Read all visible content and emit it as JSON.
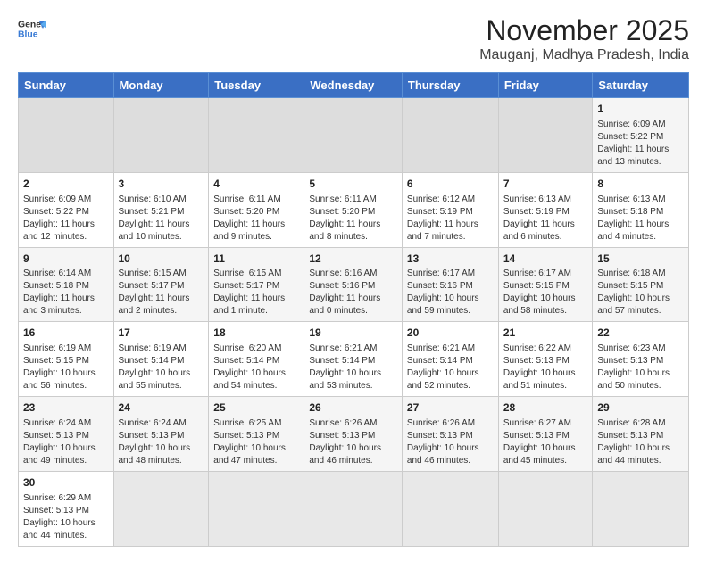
{
  "header": {
    "logo_general": "General",
    "logo_blue": "Blue",
    "month_title": "November 2025",
    "location": "Mauganj, Madhya Pradesh, India"
  },
  "days_of_week": [
    "Sunday",
    "Monday",
    "Tuesday",
    "Wednesday",
    "Thursday",
    "Friday",
    "Saturday"
  ],
  "weeks": [
    [
      {
        "day": "",
        "info": ""
      },
      {
        "day": "",
        "info": ""
      },
      {
        "day": "",
        "info": ""
      },
      {
        "day": "",
        "info": ""
      },
      {
        "day": "",
        "info": ""
      },
      {
        "day": "",
        "info": ""
      },
      {
        "day": "1",
        "info": "Sunrise: 6:09 AM\nSunset: 5:22 PM\nDaylight: 11 hours\nand 13 minutes."
      }
    ],
    [
      {
        "day": "2",
        "info": "Sunrise: 6:09 AM\nSunset: 5:22 PM\nDaylight: 11 hours\nand 12 minutes."
      },
      {
        "day": "3",
        "info": "Sunrise: 6:10 AM\nSunset: 5:21 PM\nDaylight: 11 hours\nand 10 minutes."
      },
      {
        "day": "4",
        "info": "Sunrise: 6:11 AM\nSunset: 5:20 PM\nDaylight: 11 hours\nand 9 minutes."
      },
      {
        "day": "5",
        "info": "Sunrise: 6:11 AM\nSunset: 5:20 PM\nDaylight: 11 hours\nand 8 minutes."
      },
      {
        "day": "6",
        "info": "Sunrise: 6:12 AM\nSunset: 5:19 PM\nDaylight: 11 hours\nand 7 minutes."
      },
      {
        "day": "7",
        "info": "Sunrise: 6:13 AM\nSunset: 5:19 PM\nDaylight: 11 hours\nand 6 minutes."
      },
      {
        "day": "8",
        "info": "Sunrise: 6:13 AM\nSunset: 5:18 PM\nDaylight: 11 hours\nand 4 minutes."
      }
    ],
    [
      {
        "day": "9",
        "info": "Sunrise: 6:14 AM\nSunset: 5:18 PM\nDaylight: 11 hours\nand 3 minutes."
      },
      {
        "day": "10",
        "info": "Sunrise: 6:15 AM\nSunset: 5:17 PM\nDaylight: 11 hours\nand 2 minutes."
      },
      {
        "day": "11",
        "info": "Sunrise: 6:15 AM\nSunset: 5:17 PM\nDaylight: 11 hours\nand 1 minute."
      },
      {
        "day": "12",
        "info": "Sunrise: 6:16 AM\nSunset: 5:16 PM\nDaylight: 11 hours\nand 0 minutes."
      },
      {
        "day": "13",
        "info": "Sunrise: 6:17 AM\nSunset: 5:16 PM\nDaylight: 10 hours\nand 59 minutes."
      },
      {
        "day": "14",
        "info": "Sunrise: 6:17 AM\nSunset: 5:15 PM\nDaylight: 10 hours\nand 58 minutes."
      },
      {
        "day": "15",
        "info": "Sunrise: 6:18 AM\nSunset: 5:15 PM\nDaylight: 10 hours\nand 57 minutes."
      }
    ],
    [
      {
        "day": "16",
        "info": "Sunrise: 6:19 AM\nSunset: 5:15 PM\nDaylight: 10 hours\nand 56 minutes."
      },
      {
        "day": "17",
        "info": "Sunrise: 6:19 AM\nSunset: 5:14 PM\nDaylight: 10 hours\nand 55 minutes."
      },
      {
        "day": "18",
        "info": "Sunrise: 6:20 AM\nSunset: 5:14 PM\nDaylight: 10 hours\nand 54 minutes."
      },
      {
        "day": "19",
        "info": "Sunrise: 6:21 AM\nSunset: 5:14 PM\nDaylight: 10 hours\nand 53 minutes."
      },
      {
        "day": "20",
        "info": "Sunrise: 6:21 AM\nSunset: 5:14 PM\nDaylight: 10 hours\nand 52 minutes."
      },
      {
        "day": "21",
        "info": "Sunrise: 6:22 AM\nSunset: 5:13 PM\nDaylight: 10 hours\nand 51 minutes."
      },
      {
        "day": "22",
        "info": "Sunrise: 6:23 AM\nSunset: 5:13 PM\nDaylight: 10 hours\nand 50 minutes."
      }
    ],
    [
      {
        "day": "23",
        "info": "Sunrise: 6:24 AM\nSunset: 5:13 PM\nDaylight: 10 hours\nand 49 minutes."
      },
      {
        "day": "24",
        "info": "Sunrise: 6:24 AM\nSunset: 5:13 PM\nDaylight: 10 hours\nand 48 minutes."
      },
      {
        "day": "25",
        "info": "Sunrise: 6:25 AM\nSunset: 5:13 PM\nDaylight: 10 hours\nand 47 minutes."
      },
      {
        "day": "26",
        "info": "Sunrise: 6:26 AM\nSunset: 5:13 PM\nDaylight: 10 hours\nand 46 minutes."
      },
      {
        "day": "27",
        "info": "Sunrise: 6:26 AM\nSunset: 5:13 PM\nDaylight: 10 hours\nand 46 minutes."
      },
      {
        "day": "28",
        "info": "Sunrise: 6:27 AM\nSunset: 5:13 PM\nDaylight: 10 hours\nand 45 minutes."
      },
      {
        "day": "29",
        "info": "Sunrise: 6:28 AM\nSunset: 5:13 PM\nDaylight: 10 hours\nand 44 minutes."
      }
    ],
    [
      {
        "day": "30",
        "info": "Sunrise: 6:29 AM\nSunset: 5:13 PM\nDaylight: 10 hours\nand 44 minutes."
      },
      {
        "day": "",
        "info": ""
      },
      {
        "day": "",
        "info": ""
      },
      {
        "day": "",
        "info": ""
      },
      {
        "day": "",
        "info": ""
      },
      {
        "day": "",
        "info": ""
      },
      {
        "day": "",
        "info": ""
      }
    ]
  ]
}
